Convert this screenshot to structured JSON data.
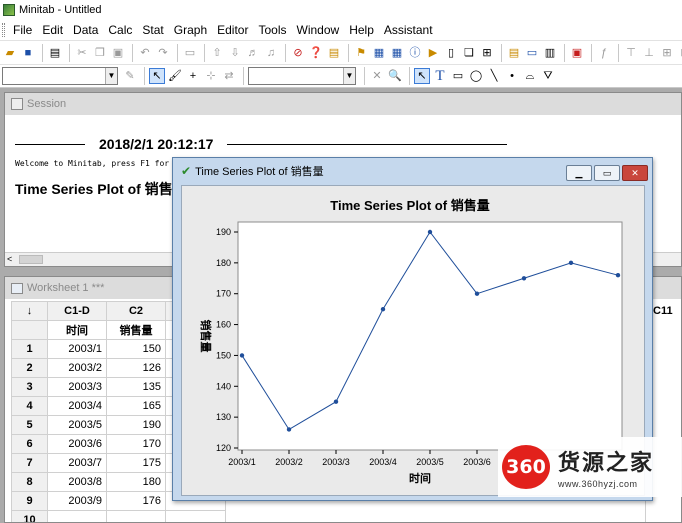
{
  "window": {
    "title": "Minitab - Untitled"
  },
  "menu": [
    "File",
    "Edit",
    "Data",
    "Calc",
    "Stat",
    "Graph",
    "Editor",
    "Tools",
    "Window",
    "Help",
    "Assistant"
  ],
  "session": {
    "title": "Session",
    "datetime": "2018/2/1 20:12:17",
    "welcome": "Welcome to Minitab, press F1 for",
    "heading": "Time Series Plot of 销售量"
  },
  "worksheet": {
    "title": "Worksheet 1 ***",
    "corner": "↓",
    "col_ids": [
      "C1-D",
      "C2"
    ],
    "col_names": [
      "时间",
      "销售量"
    ],
    "extra_col": "C11",
    "rows": [
      {
        "n": "1",
        "t": "2003/1",
        "v": "150"
      },
      {
        "n": "2",
        "t": "2003/2",
        "v": "126"
      },
      {
        "n": "3",
        "t": "2003/3",
        "v": "135"
      },
      {
        "n": "4",
        "t": "2003/4",
        "v": "165"
      },
      {
        "n": "5",
        "t": "2003/5",
        "v": "190"
      },
      {
        "n": "6",
        "t": "2003/6",
        "v": "170"
      },
      {
        "n": "7",
        "t": "2003/7",
        "v": "175"
      },
      {
        "n": "8",
        "t": "2003/8",
        "v": "180"
      },
      {
        "n": "9",
        "t": "2003/9",
        "v": "176"
      },
      {
        "n": "10",
        "t": "",
        "v": ""
      }
    ]
  },
  "graph": {
    "window_title": "Time Series Plot of 销售量",
    "close_glyph": "✕",
    "min_glyph": "▁",
    "max_glyph": "▭"
  },
  "chart_data": {
    "type": "line",
    "title": "Time Series Plot of 销售量",
    "xlabel": "时间",
    "ylabel": "销售量",
    "categories": [
      "2003/1",
      "2003/2",
      "2003/3",
      "2003/4",
      "2003/5",
      "2003/6",
      "2003/7",
      "2003/8",
      "2003/9"
    ],
    "x_tick_labels": [
      "2003/1",
      "2003/2",
      "2003/3",
      "2003/4",
      "2003/5",
      "2003/6"
    ],
    "values": [
      150,
      126,
      135,
      165,
      190,
      170,
      175,
      180,
      176
    ],
    "ylim": [
      120,
      190
    ],
    "y_ticks": [
      120,
      130,
      140,
      150,
      160,
      170,
      180,
      190
    ],
    "color": "#1f4e9a",
    "grid": false
  },
  "watermark": {
    "badge": "360",
    "brand": "货源之家",
    "url": "www.360hyzj.com"
  }
}
